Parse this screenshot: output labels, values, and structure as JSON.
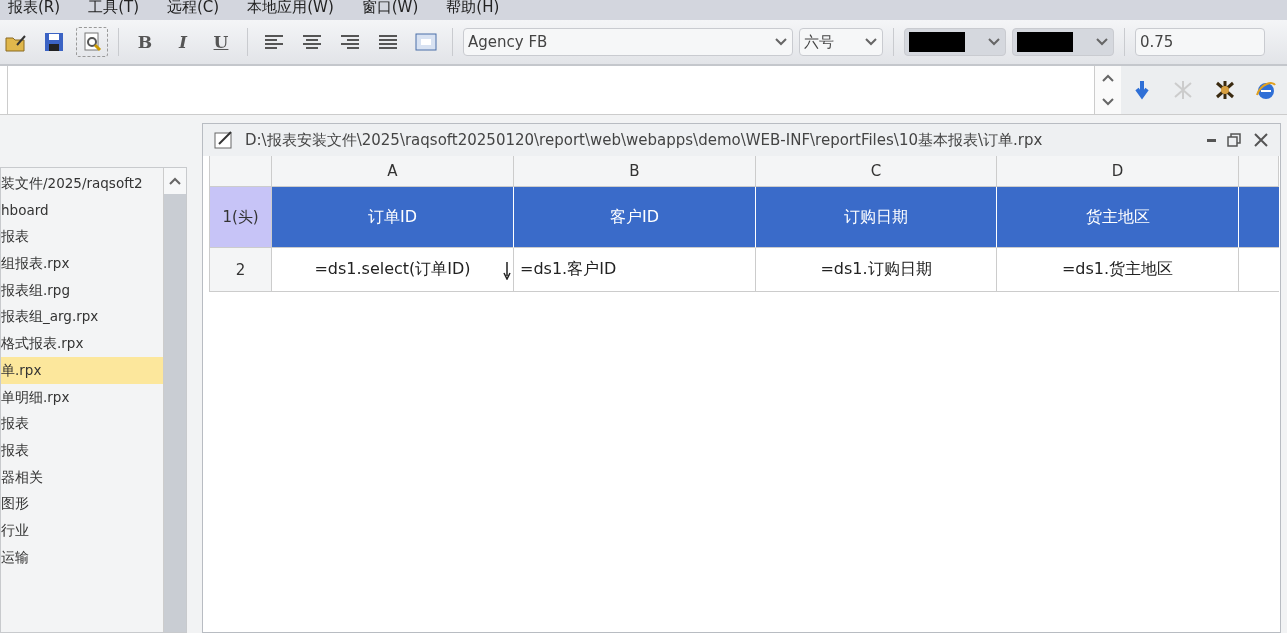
{
  "menu": [
    "报表(R)",
    "工具(T)",
    "远程(C)",
    "本地应用(W)",
    "窗口(W)",
    "帮助(H)"
  ],
  "toolbar": {
    "bold": "B",
    "italic": "I",
    "underline": "U",
    "font": "Agency FB",
    "size": "六号",
    "zoom": "0.75",
    "preview_selected": true
  },
  "tree": [
    {
      "label": "装文件/2025/raqsoft2",
      "selected": false
    },
    {
      "label": "hboard",
      "selected": false
    },
    {
      "label": "报表",
      "selected": false
    },
    {
      "label": "组报表.rpx",
      "selected": false
    },
    {
      "label": "报表组.rpg",
      "selected": false
    },
    {
      "label": "报表组_arg.rpx",
      "selected": false
    },
    {
      "label": "格式报表.rpx",
      "selected": false
    },
    {
      "label": "单.rpx",
      "selected": true
    },
    {
      "label": "单明细.rpx",
      "selected": false
    },
    {
      "label": "报表",
      "selected": false
    },
    {
      "label": "报表",
      "selected": false
    },
    {
      "label": "器相关",
      "selected": false
    },
    {
      "label": "图形",
      "selected": false
    },
    {
      "label": "行业",
      "selected": false
    },
    {
      "label": "运输",
      "selected": false
    }
  ],
  "sheet": {
    "title": "D:\\报表安装文件\\2025\\raqsoft20250120\\report\\web\\webapps\\demo\\WEB-INF\\reportFiles\\10基本报表\\订单.rpx",
    "columns": [
      "A",
      "B",
      "C",
      "D"
    ],
    "rows": [
      {
        "label": "1(头)",
        "kind": "header",
        "cells": [
          {
            "text": "订单ID"
          },
          {
            "text": "客户ID"
          },
          {
            "text": "订购日期"
          },
          {
            "text": "货主地区"
          }
        ]
      },
      {
        "label": "2",
        "kind": "data",
        "cells": [
          {
            "text": "=ds1.select(订单ID)",
            "dropdown": true
          },
          {
            "text": "=ds1.客户ID"
          },
          {
            "text": "=ds1.订购日期"
          },
          {
            "text": "=ds1.货主地区"
          }
        ]
      }
    ]
  }
}
